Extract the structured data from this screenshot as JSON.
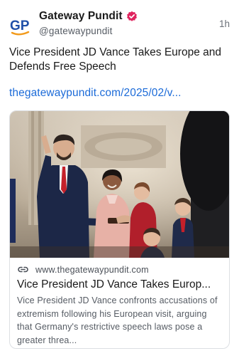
{
  "post": {
    "author": {
      "avatar_icon": "gp-logo-icon",
      "avatar_text": "GP",
      "display_name": "Gateway Pundit",
      "verified_icon": "verified-badge-icon",
      "handle": "@gatewaypundit"
    },
    "timestamp": "1h",
    "text": "Vice President JD Vance Takes Europe and Defends Free Speech",
    "link_text": "thegatewaypundit.com/2025/02/v...",
    "link_card": {
      "image_alt": "Photo of JD Vance being sworn in with his family",
      "link_icon": "link-icon",
      "domain": "www.thegatewaypundit.com",
      "title": "Vice President JD Vance Takes Europ...",
      "description": "Vice President JD Vance confronts accusations of extremism following his European visit, arguing that Germany's restrictive speech laws pose a greater threa..."
    }
  },
  "colors": {
    "link_blue": "#1c6bd8",
    "logo_blue": "#1f4fa8",
    "logo_orange": "#f29a1b",
    "verified_pink": "#e0245e"
  }
}
